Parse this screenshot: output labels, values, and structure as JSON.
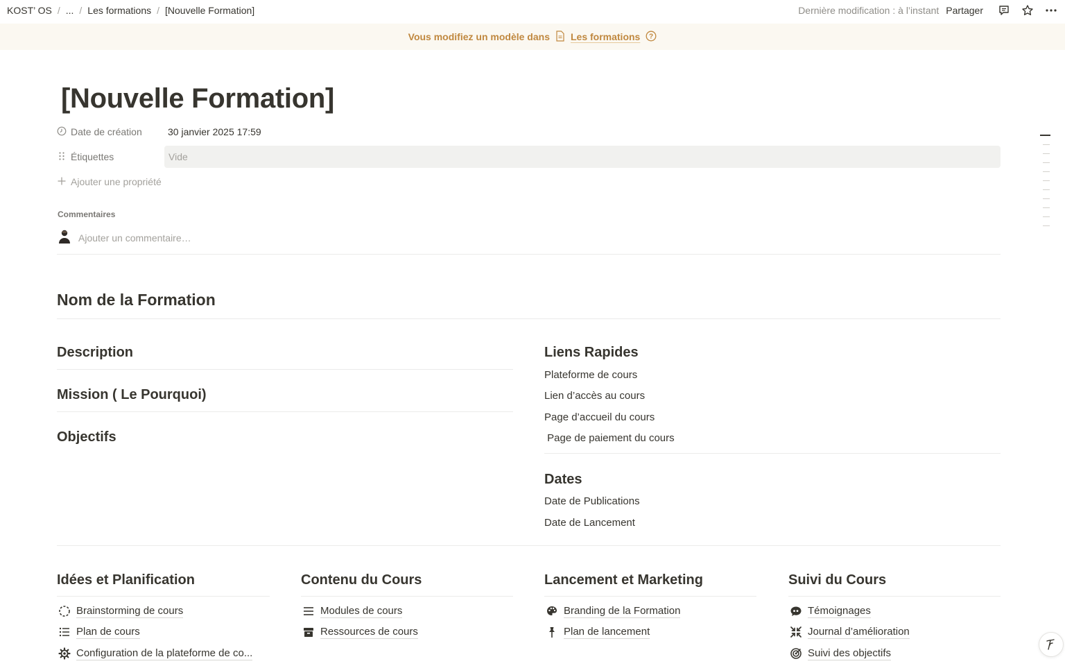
{
  "breadcrumb": {
    "items": [
      "KOST’ OS",
      "...",
      "Les formations",
      "[Nouvelle Formation]"
    ]
  },
  "topbar": {
    "last_modified": "Dernière modification : à l’instant",
    "share_label": "Partager"
  },
  "banner": {
    "text": "Vous modifiez un modèle dans",
    "link": "Les formations"
  },
  "page": {
    "title": "[Nouvelle Formation]",
    "properties": [
      {
        "name": "Date de création",
        "value": "30 janvier 2025 17:59"
      },
      {
        "name": "Étiquettes",
        "value": "Vide"
      }
    ],
    "add_property": "Ajouter une propriété",
    "comments_label": "Commentaires",
    "comment_placeholder": "Ajouter un commentaire…"
  },
  "content": {
    "nom_heading": "Nom de la Formation",
    "left": {
      "description": "Description",
      "mission": "Mission ( Le Pourquoi)",
      "objectifs": "Objectifs"
    },
    "liens": {
      "heading": "Liens Rapides",
      "items": [
        "Plateforme de cours",
        "Lien d’accès au cours",
        "Page d’accueil du cours",
        " Page de paiement du cours"
      ]
    },
    "dates": {
      "heading": "Dates",
      "items": [
        "Date de Publications",
        "Date de Lancement"
      ]
    }
  },
  "columns": [
    {
      "heading": "Idées et Planification",
      "links": [
        {
          "label": "Brainstorming de cours",
          "icon": "dashed-circle-icon"
        },
        {
          "label": "Plan de cours",
          "icon": "list-icon"
        },
        {
          "label": "Configuration de la plateforme de co...",
          "icon": "gear-icon"
        }
      ]
    },
    {
      "heading": "Contenu du Cours",
      "links": [
        {
          "label": "Modules de cours",
          "icon": "menu-lines-icon"
        },
        {
          "label": "Ressources de cours",
          "icon": "archive-box-icon"
        }
      ]
    },
    {
      "heading": "Lancement et Marketing",
      "links": [
        {
          "label": "Branding de la Formation",
          "icon": "palette-icon"
        },
        {
          "label": "Plan de lancement",
          "icon": "pushpin-icon"
        }
      ]
    },
    {
      "heading": "Suivi du Cours",
      "links": [
        {
          "label": "Témoignages",
          "icon": "quote-bubble-icon"
        },
        {
          "label": "Journal d’amélioration",
          "icon": "compress-arrows-icon"
        },
        {
          "label": "Suivi des objectifs",
          "icon": "target-icon"
        }
      ]
    }
  ]
}
